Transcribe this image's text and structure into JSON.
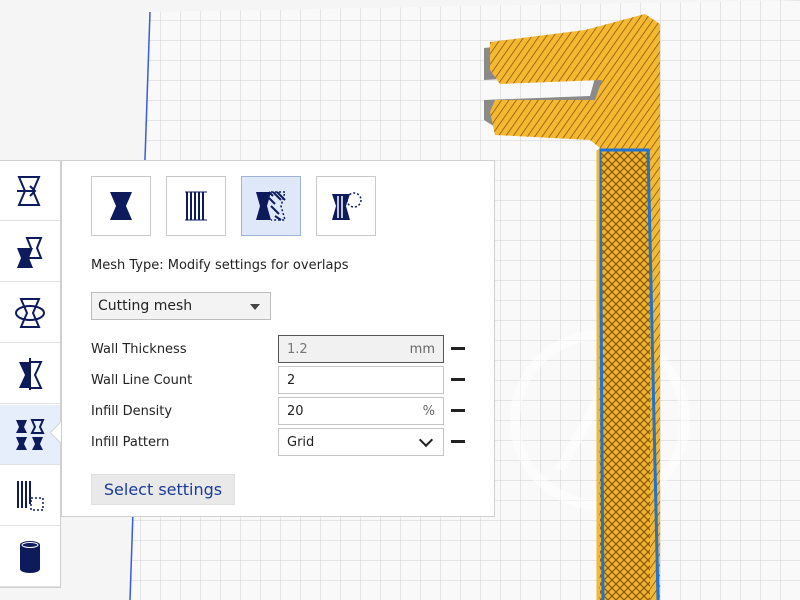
{
  "toolbar": {
    "tools": [
      {
        "name": "move-tool",
        "icon": "move-icon"
      },
      {
        "name": "scale-tool",
        "icon": "scale-icon"
      },
      {
        "name": "rotate-tool",
        "icon": "rotate-icon"
      },
      {
        "name": "mirror-tool",
        "icon": "mirror-icon"
      },
      {
        "name": "per-model-settings-tool",
        "icon": "per-model-settings-icon",
        "active": true
      },
      {
        "name": "support-blocker-tool",
        "icon": "support-blocker-icon"
      },
      {
        "name": "cylinder-tool",
        "icon": "cylinder-icon"
      }
    ]
  },
  "panel": {
    "mesh_buttons": [
      {
        "name": "normal-model",
        "icon": "normal-model-icon"
      },
      {
        "name": "print-as-support",
        "icon": "support-mesh-icon"
      },
      {
        "name": "modify-settings-for-overlaps",
        "icon": "overlap-mesh-icon",
        "selected": true
      },
      {
        "name": "dont-support-overlaps",
        "icon": "anti-overhang-icon"
      }
    ],
    "mesh_type_text": "Mesh Type: Modify settings for overlaps",
    "mesh_select_value": "Cutting mesh",
    "settings": [
      {
        "label": "Wall Thickness",
        "value": "1.2",
        "unit": "mm",
        "disabled": true
      },
      {
        "label": "Wall Line Count",
        "value": "2",
        "unit": ""
      },
      {
        "label": "Infill Density",
        "value": "20",
        "unit": "%"
      },
      {
        "label": "Infill Pattern",
        "value": "Grid",
        "unit": "",
        "dropdown": true
      }
    ],
    "select_settings_label": "Select settings"
  },
  "colors": {
    "model_yellow": "#f5b833",
    "highlight_blue": "#1e73d4",
    "accent_navy": "#0d1a5c",
    "grid_line": "#cfcfcf",
    "build_plate": "#f7f7f7"
  }
}
